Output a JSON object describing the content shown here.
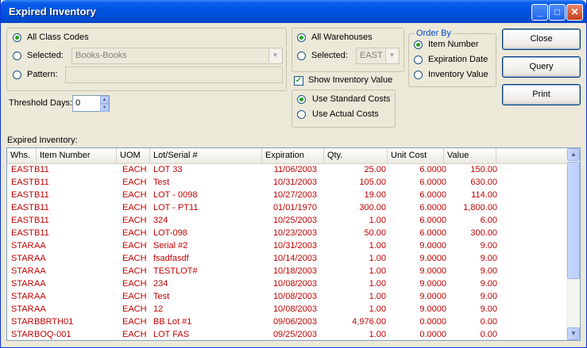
{
  "window": {
    "title": "Expired Inventory",
    "controls": {
      "minimize": "_",
      "maximize": "□",
      "close": "✕"
    }
  },
  "class_codes": {
    "all_label": "All Class Codes",
    "selected_label": "Selected:",
    "selected_value": "Books-Books",
    "pattern_label": "Pattern:",
    "pattern_value": "",
    "mode": "all"
  },
  "threshold": {
    "label": "Threshold Days:",
    "value": "0"
  },
  "warehouses": {
    "all_label": "All Warehouses",
    "selected_label": "Selected:",
    "selected_value": "EAST",
    "mode": "all"
  },
  "show_inventory_value": {
    "label": "Show Inventory Value",
    "checked": true
  },
  "costs": {
    "standard_label": "Use Standard Costs",
    "actual_label": "Use Actual Costs",
    "mode": "standard"
  },
  "order_by": {
    "legend": "Order By",
    "item_number": "Item Number",
    "expiration_date": "Expiration Date",
    "inventory_value": "Inventory Value",
    "mode": "item_number"
  },
  "buttons": {
    "close": "Close",
    "query": "Query",
    "print": "Print"
  },
  "grid": {
    "caption": "Expired Inventory:",
    "columns": [
      "Whs.",
      "Item Number",
      "UOM",
      "Lot/Serial #",
      "Expiration",
      "Qty.",
      "Unit Cost",
      "Value"
    ],
    "rows": [
      [
        "EAST",
        "B11",
        "EACH",
        "LOT 33",
        "11/06/2003",
        "25.00",
        "6.0000",
        "150.00"
      ],
      [
        "EAST",
        "B11",
        "EACH",
        "Test",
        "10/31/2003",
        "105.00",
        "6.0000",
        "630.00"
      ],
      [
        "EAST",
        "B11",
        "EACH",
        "LOT - 0098",
        "10/27/2003",
        "19.00",
        "6.0000",
        "114.00"
      ],
      [
        "EAST",
        "B11",
        "EACH",
        "LOT - PT11",
        "01/01/1970",
        "300.00",
        "6.0000",
        "1,800.00"
      ],
      [
        "EAST",
        "B11",
        "EACH",
        "324",
        "10/25/2003",
        "1.00",
        "6.0000",
        "6.00"
      ],
      [
        "EAST",
        "B11",
        "EACH",
        "LOT-098",
        "10/23/2003",
        "50.00",
        "6.0000",
        "300.00"
      ],
      [
        "STAR",
        "AA",
        "EACH",
        "Serial #2",
        "10/31/2003",
        "1.00",
        "9.0000",
        "9.00"
      ],
      [
        "STAR",
        "AA",
        "EACH",
        "fsadfasdf",
        "10/14/2003",
        "1.00",
        "9.0000",
        "9.00"
      ],
      [
        "STAR",
        "AA",
        "EACH",
        "TESTLOT#",
        "10/18/2003",
        "1.00",
        "9.0000",
        "9.00"
      ],
      [
        "STAR",
        "AA",
        "EACH",
        "234",
        "10/08/2003",
        "1.00",
        "9.0000",
        "9.00"
      ],
      [
        "STAR",
        "AA",
        "EACH",
        "Test",
        "10/08/2003",
        "1.00",
        "9.0000",
        "9.00"
      ],
      [
        "STAR",
        "AA",
        "EACH",
        "12",
        "10/08/2003",
        "1.00",
        "9.0000",
        "9.00"
      ],
      [
        "STAR",
        "BBRTH01",
        "EACH",
        "BB Lot #1",
        "09/06/2003",
        "4,976.00",
        "0.0000",
        "0.00"
      ],
      [
        "STAR",
        "BOQ-001",
        "EACH",
        "LOT FAS",
        "09/25/2003",
        "1.00",
        "0.0000",
        "0.00"
      ]
    ]
  },
  "colors": {
    "row_text": "#C00000",
    "title_bar": "#0054E3",
    "dialog_bg": "#ECE9D8"
  }
}
